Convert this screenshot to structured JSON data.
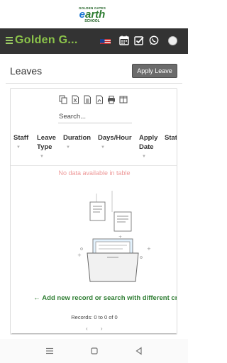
{
  "logo": {
    "top": "GOLDEN GATES",
    "main_a": "e",
    "main_b": "arth",
    "bottom": "SCHOOL"
  },
  "header": {
    "brand": "Golden G...",
    "icons": [
      "menu-icon",
      "us-flag-icon",
      "calendar-icon",
      "checkbox-icon",
      "whatsapp-icon",
      "avatar"
    ]
  },
  "page": {
    "title": "Leaves",
    "apply_button": "Apply Leave"
  },
  "grid": {
    "toolbar_icons": [
      "copy-icon",
      "excel-icon",
      "csv-icon",
      "pdf-icon",
      "print-icon",
      "columns-icon"
    ],
    "search_placeholder": "Search...",
    "columns": [
      "Staff",
      "Leave Type",
      "Duration",
      "Days/Hour",
      "Apply Date",
      "Stat"
    ],
    "empty_message": "No data available in table",
    "add_record": "Add new record or search with different crit",
    "records_text": "Records: 0 to 0 of 0",
    "pager": "‹ ›"
  },
  "colors": {
    "header_bg": "#333333",
    "brand_green": "#8bc34a",
    "button_gray": "#6b6b6b",
    "empty_text": "#ee9a9a",
    "link_green": "#2e7d32"
  }
}
